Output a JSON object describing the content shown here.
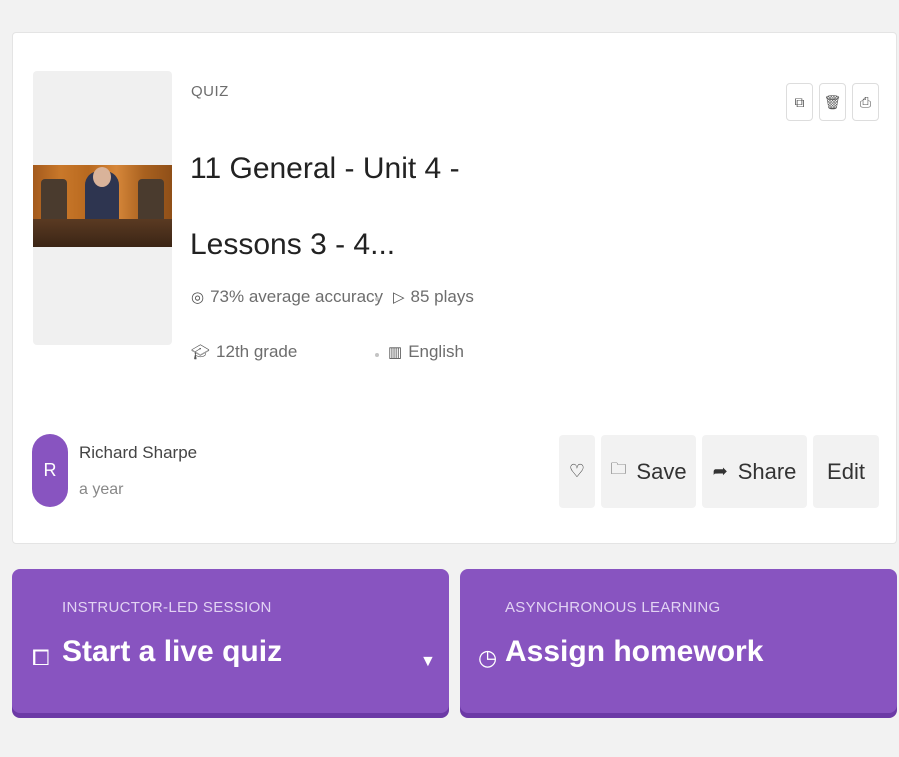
{
  "quiz": {
    "type_label": "QUIZ",
    "title": "11 General - Unit 4 - Lessons 3 - 4...",
    "accuracy": "73% average accuracy",
    "plays": "85 plays",
    "grade": "12th grade",
    "language": "English"
  },
  "icons": {
    "accuracy": "target-icon",
    "plays": "play-icon",
    "grade": "graduation-cap-icon",
    "language": "books-icon",
    "copy": "copy-icon",
    "delete": "trash-icon",
    "print": "print-icon",
    "like": "heart-icon",
    "save": "folder-icon",
    "share": "share-icon",
    "live": "presentation-icon",
    "homework": "clock-icon",
    "dropdown": "caret-down-icon"
  },
  "author": {
    "initial": "R",
    "name": "Richard Sharpe",
    "time": "a year"
  },
  "actions": {
    "save_label": "Save",
    "share_label": "Share",
    "edit_label": "Edit"
  },
  "cta": {
    "live": {
      "sub": "INSTRUCTOR-LED SESSION",
      "main": "Start a live quiz"
    },
    "homework": {
      "sub": "ASYNCHRONOUS LEARNING",
      "main": "Assign homework"
    }
  },
  "colors": {
    "accent": "#8854c0",
    "accent_shadow": "#6c3aa6",
    "button_bg": "#f2f2f2"
  }
}
